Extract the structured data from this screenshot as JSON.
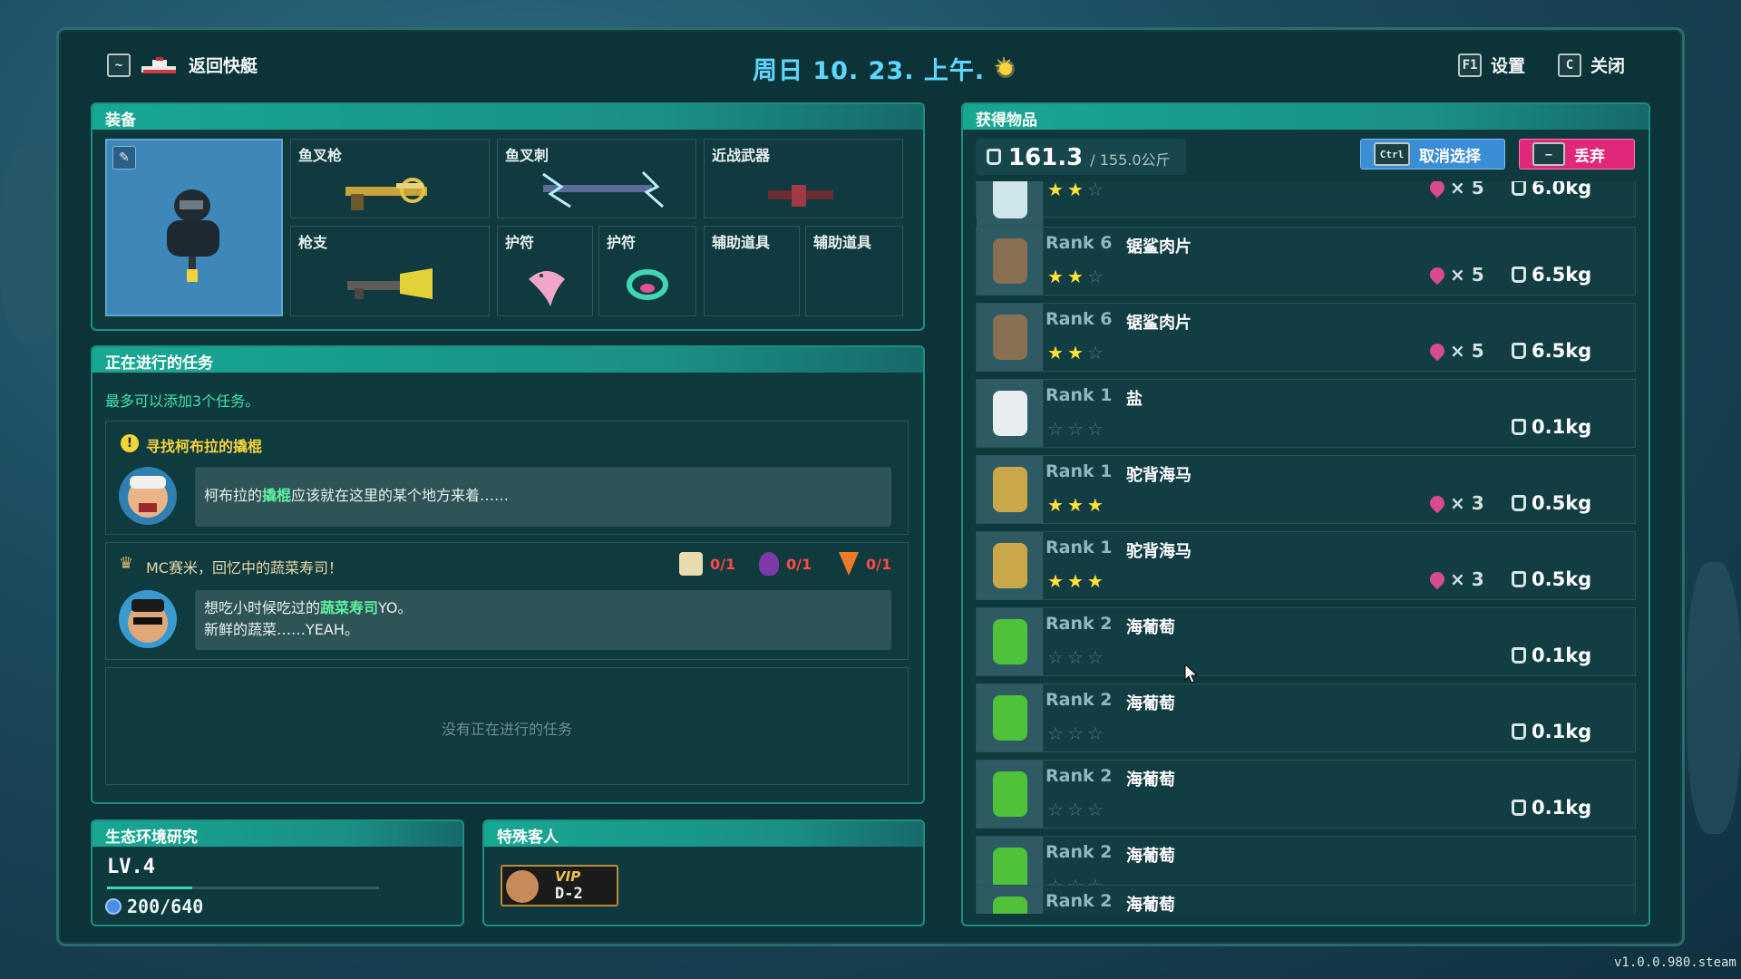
{
  "topbar": {
    "back_key": "~",
    "back_label": "返回快艇",
    "date": "周日 10. 23. 上午.",
    "settings_key": "F1",
    "settings_label": "设置",
    "close_key": "C",
    "close_label": "关闭"
  },
  "equipment": {
    "title": "装备",
    "slots": [
      "鱼叉枪",
      "鱼叉刺",
      "近战武器",
      "枪支",
      "护符",
      "护符",
      "辅助道具",
      "辅助道具"
    ]
  },
  "quests": {
    "title": "正在进行的任务",
    "limit_note": "最多可以添加3个任务。",
    "quest1": {
      "title": "寻找柯布拉的撬棍",
      "text_a": "柯布拉的",
      "text_hl": "撬棍",
      "text_b": "应该就在这里的某个地方来着……"
    },
    "quest2": {
      "title": "MC赛米，回忆中的蔬菜寿司！",
      "req1": "0/1",
      "req2": "0/1",
      "req3": "0/1",
      "line1_a": "想吃小时候吃过的",
      "line1_hl": "蔬菜寿司",
      "line1_b": "YO。",
      "line2": "新鲜的蔬菜……YEAH。"
    },
    "empty": "没有正在进行的任务"
  },
  "eco": {
    "title": "生态环境研究",
    "level": "LV.4",
    "progress_text": "200/640",
    "progress": 0.3125
  },
  "guest": {
    "title": "特殊客人",
    "vip_label": "VIP",
    "vip_code": "D-2"
  },
  "items": {
    "title": "获得物品",
    "weight_current": "161.3",
    "weight_max": "/ 155.0公斤",
    "cancel_key": "Ctrl",
    "cancel_label": "取消选择",
    "discard_key": "—",
    "discard_label": "丢弃",
    "rows": [
      {
        "rank": "",
        "name": "",
        "stars": 2,
        "count": "× 5",
        "weight": "6.0kg"
      },
      {
        "rank": "Rank 6",
        "name": "锯鲨肉片",
        "stars": 2,
        "count": "× 5",
        "weight": "6.5kg"
      },
      {
        "rank": "Rank 6",
        "name": "锯鲨肉片",
        "stars": 2,
        "count": "× 5",
        "weight": "6.5kg"
      },
      {
        "rank": "Rank 1",
        "name": "盐",
        "stars": 0,
        "count": "",
        "weight": "0.1kg"
      },
      {
        "rank": "Rank 1",
        "name": "驼背海马",
        "stars": 3,
        "count": "× 3",
        "weight": "0.5kg"
      },
      {
        "rank": "Rank 1",
        "name": "驼背海马",
        "stars": 3,
        "count": "× 3",
        "weight": "0.5kg"
      },
      {
        "rank": "Rank 2",
        "name": "海葡萄",
        "stars": 0,
        "count": "",
        "weight": "0.1kg"
      },
      {
        "rank": "Rank 2",
        "name": "海葡萄",
        "stars": 0,
        "count": "",
        "weight": "0.1kg"
      },
      {
        "rank": "Rank 2",
        "name": "海葡萄",
        "stars": 0,
        "count": "",
        "weight": "0.1kg"
      },
      {
        "rank": "Rank 2",
        "name": "海葡萄",
        "stars": 0,
        "count": "",
        "weight": ""
      },
      {
        "rank": "Rank 2",
        "name": "海葡萄",
        "stars": 0,
        "count": "",
        "weight": ""
      }
    ]
  },
  "version": "v1.0.0.980.steam",
  "colors": {
    "accent": "#17a892",
    "date": "#5fd8ff",
    "discard": "#e0287a",
    "cancel": "#3b8ed6"
  }
}
